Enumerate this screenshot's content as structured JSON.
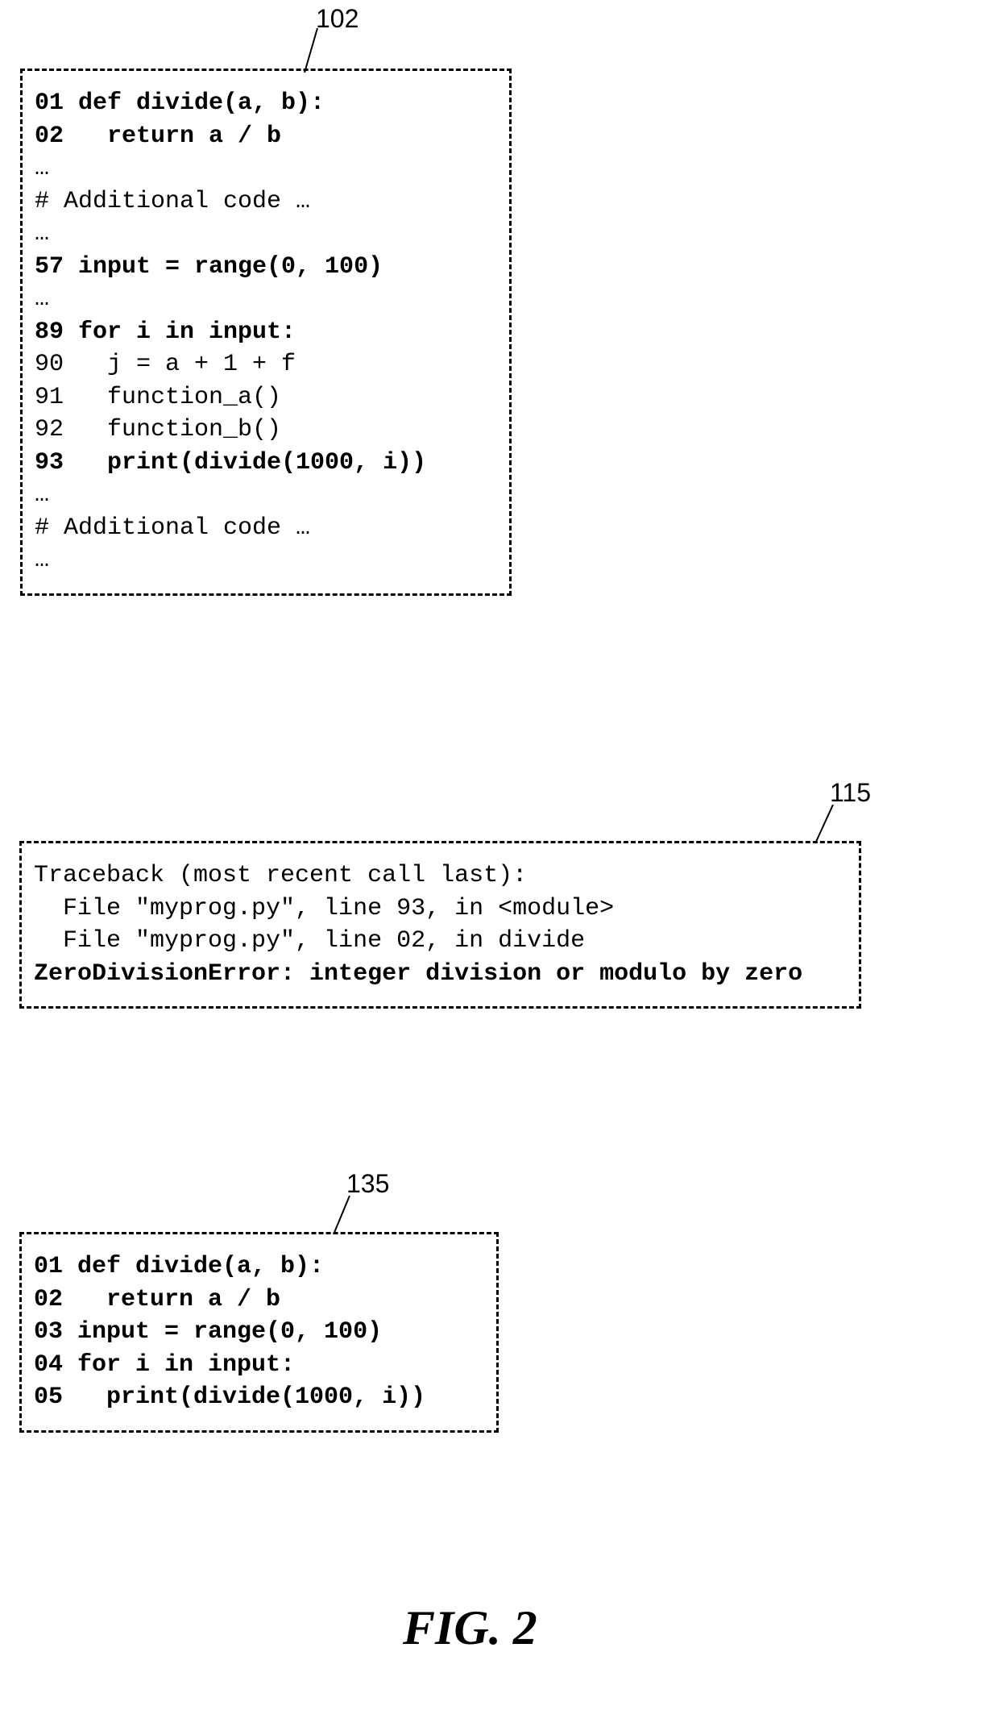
{
  "box1": {
    "callout": "102",
    "lines": [
      "01 def divide(a, b):",
      "02   return a / b",
      "…",
      "# Additional code …",
      "…",
      "57 input = range(0, 100)",
      "…",
      "89 for i in input:",
      "90   j = a + 1 + f",
      "91   function_a()",
      "92   function_b()",
      "93   print(divide(1000, i))",
      "…",
      "# Additional code …",
      "…"
    ],
    "bold": [
      true,
      true,
      false,
      false,
      false,
      true,
      false,
      true,
      false,
      false,
      false,
      true,
      false,
      false,
      false
    ]
  },
  "box2": {
    "callout": "115",
    "lines": [
      "Traceback (most recent call last):",
      "  File \"myprog.py\", line 93, in <module>",
      "  File \"myprog.py\", line 02, in divide",
      "ZeroDivisionError: integer division or modulo by zero"
    ],
    "bold": [
      false,
      false,
      false,
      true
    ]
  },
  "box3": {
    "callout": "135",
    "lines": [
      "01 def divide(a, b):",
      "02   return a / b",
      "03 input = range(0, 100)",
      "04 for i in input:",
      "05   print(divide(1000, i))"
    ],
    "bold": [
      true,
      true,
      true,
      true,
      true
    ]
  },
  "figure_label": "FIG. 2"
}
